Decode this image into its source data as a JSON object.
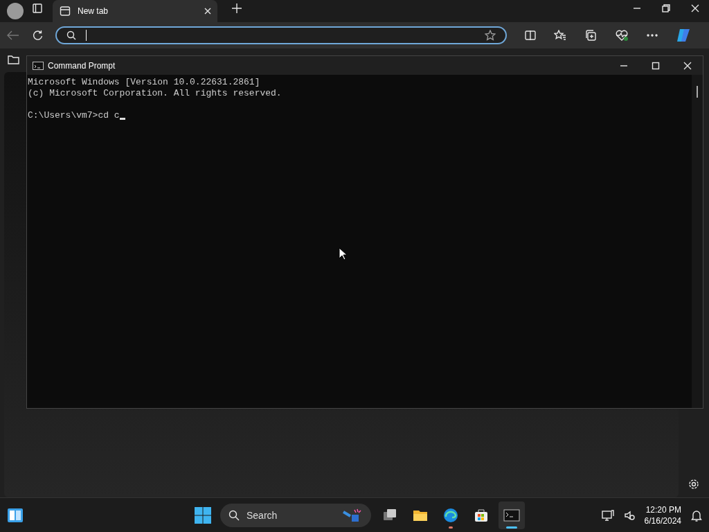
{
  "browser": {
    "tabs": [
      {
        "label": "New tab",
        "selected": true
      }
    ]
  },
  "console_window": {
    "title": "Command Prompt",
    "lines": [
      {
        "kind": "output",
        "text": "Microsoft Windows [Version 10.0.22631.2861]"
      },
      {
        "kind": "output",
        "text": "(c) Microsoft Corporation. All rights reserved."
      },
      {
        "kind": "prompt",
        "text": "C:\\Users\\vm7>cd c"
      }
    ]
  },
  "taskbar": {
    "search": {
      "label": "Search"
    },
    "apps": [
      {
        "kind": "task-view",
        "running": false,
        "selected": false
      },
      {
        "kind": "files",
        "running": false,
        "selected": false
      },
      {
        "kind": "browser",
        "running": true,
        "selected": false
      },
      {
        "kind": "store",
        "running": false,
        "selected": false
      },
      {
        "kind": "terminal",
        "running": true,
        "selected": true
      }
    ],
    "time": "12:20 PM",
    "date": "6/16/2024"
  }
}
